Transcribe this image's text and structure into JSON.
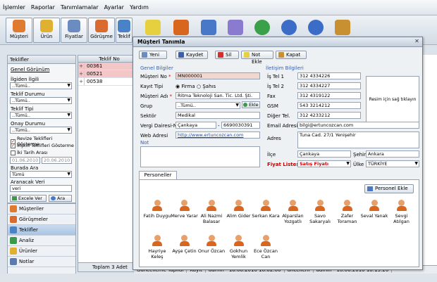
{
  "menu": [
    "İşlemler",
    "Raporlar",
    "Tanımlamalar",
    "Ayarlar",
    "Yardım"
  ],
  "toolbar": [
    {
      "label": "Müşteri",
      "icon": "customers-icon",
      "color": "#e07a2e"
    },
    {
      "label": "Ürün",
      "icon": "product-icon",
      "color": "#e0b030"
    },
    {
      "label": "Fiyatlar",
      "icon": "price-calculator-icon",
      "color": "#6a8cc0"
    },
    {
      "label": "Görüşme",
      "icon": "meeting-icon",
      "color": "#d96a30"
    },
    {
      "label": "Teklif",
      "icon": "offer-icon",
      "color": "#4a82c8"
    }
  ],
  "toolbar_extra_icons": [
    {
      "icon": "note-icon",
      "color": "#e6d040"
    },
    {
      "icon": "contacts-icon",
      "color": "#d9661f"
    },
    {
      "icon": "approve-icon",
      "color": "#4a78c8"
    },
    {
      "icon": "settings-icon",
      "color": "#8a7ad0"
    },
    {
      "icon": "globe-icon",
      "color": "#3aa04a"
    },
    {
      "icon": "info-icon",
      "color": "#3a6cc8"
    },
    {
      "icon": "help-icon",
      "color": "#3a6cc8"
    },
    {
      "icon": "exit-icon",
      "color": "#c89030"
    }
  ],
  "left": {
    "header": "Teklifler",
    "general_view": "Genel Görünüm",
    "responsible_label": "İlgiden İlgili",
    "responsible_value": "..Tümü..",
    "offer_status_label": "Teklif Durumu",
    "offer_status_value": "..Tümü..",
    "offer_type_label": "Teklif Tipi",
    "offer_type_value": "..Tümü..",
    "approval_label": "Onay Durumu",
    "approval_value": "..Tümü..",
    "cb_revize": "Revize Teklifleri Gösterme",
    "cb_iliskili": "İlişkili Teklifleri Gösterme",
    "cb_dates": "İki Tarih Arası",
    "date_from": "01.06.2010",
    "date_to": "20.06.2010",
    "search_in_label": "Burada Ara",
    "search_in_value": "Tümü",
    "search_text_label": "Aranacak Veri",
    "search_text_value": "veri",
    "excel_button": "Excele Ver",
    "search_button": "Ara"
  },
  "nav": [
    {
      "label": "Müşteriler",
      "color": "#e07a2e",
      "active": false
    },
    {
      "label": "Görüşmeler",
      "color": "#d96a30",
      "active": false
    },
    {
      "label": "Teklifler",
      "color": "#4a82c8",
      "active": true
    },
    {
      "label": "Analiz",
      "color": "#3a9a4a",
      "active": false
    },
    {
      "label": "Ürünler",
      "color": "#e0b030",
      "active": false
    },
    {
      "label": "Notlar",
      "color": "#5a7ab0",
      "active": false
    }
  ],
  "grid": {
    "header": "Teklif No",
    "rows": [
      "00361",
      "00521",
      "00538"
    ],
    "footer": "Toplam 3 Adet"
  },
  "status": {
    "left": "Güncelleme Yapıldı",
    "record": "Kayıt",
    "record_info": "admin - 18.06.2010 18:02:00",
    "update": "üncellem",
    "update_info": "admin - 18.06.2010 18:13:20"
  },
  "dialog": {
    "title": "Müşteri Tanımla",
    "buttons": {
      "new": "Yeni",
      "save": "Kaydet",
      "delete": "Sil",
      "note": "Not Ekle",
      "close": "Kapat"
    },
    "general_section": "Genel Bilgiler",
    "contact_section": "İletişim Bilgileri",
    "customer_no_label": "Müşteri No",
    "customer_no": "MN000001",
    "record_type_label": "Kayıt Tipi",
    "type_company": "Firma",
    "type_person": "Şahıs",
    "customer_name_label": "Müşteri Adı",
    "customer_name": "Ritma Teknoloji San. Tic. Ltd. Şti.",
    "group_label": "Grup",
    "group_value": "..Tümü..",
    "group_add": "Ekle",
    "sector_label": "Sektör",
    "sector_value": "Medikal",
    "tax_label": "Vergi Dairesi-No",
    "tax_office": "Çankaya",
    "tax_no": "6690030391",
    "web_label": "Web Adresi",
    "web_value": "http://www.ertuncozcan.com",
    "note_label": "Not",
    "phone1_label": "İş Tel 1",
    "phone1": "312 4334226",
    "phone2_label": "İş Tel 2",
    "phone2": "312 4334227",
    "fax_label": "Fax",
    "fax": "312 4319122",
    "gsm_label": "GSM",
    "gsm": "543 3214212",
    "other_phone_label": "Diğer Tel.",
    "other_phone": "312 4233212",
    "email_label": "Email Adresi",
    "email": "bilgi@ertuncozcan.com",
    "address_label": "Adres",
    "address": "Tuna Cad. 27/1 Yenişehir",
    "picture_hint": "Resim için sağ tıklayın",
    "district_label": "İlçe",
    "district": "Çankaya",
    "city_label": "Şehir",
    "city": "Ankara",
    "pricelist_label": "Fiyat Listesi",
    "pricelist": "Satış Fiyatı",
    "country_label": "Ülke",
    "country": "TÜRKİYE",
    "personnel_tab": "Personeller [15]",
    "add_personnel": "Personel Ekle",
    "personnel": [
      "Fatih Duygu",
      "Merve Yarar",
      "Ali Nazmi Balasar",
      "Alim Gider",
      "Serkan Kara",
      "Alparslan Yozgatlı",
      "Savo Sakaryalı",
      "Zafer Toraman",
      "Seval Yanak",
      "Sevgi Atılgan",
      "Hayriye Keleş",
      "Ayşe Çetin",
      "Onur Özcan",
      "Gokhun Yemlik",
      "Ece Özcan Can"
    ]
  }
}
